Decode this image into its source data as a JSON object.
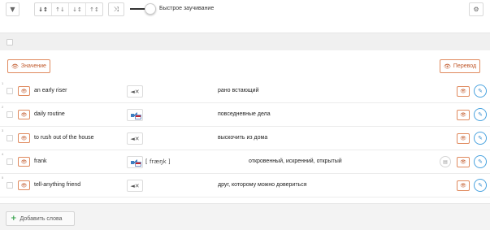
{
  "toolbar": {
    "filter_icon": "filter-icon",
    "sort_options": [
      "↓↕",
      "↑↓",
      "↓↕",
      "↑↕"
    ],
    "shuffle_icon": "shuffle-icon",
    "toggle_on": true,
    "toggle_label": "Быстрое заучивание",
    "settings_icon": "gear-icon"
  },
  "columns": {
    "meaning_label": "Значение",
    "translation_label": "Перевод"
  },
  "rows": [
    {
      "num": "1",
      "term": "an early riser",
      "audio": "none",
      "transcription": "",
      "translation": "рано встающий",
      "has_note": false
    },
    {
      "num": "2",
      "term": "daily routine",
      "audio": "sound",
      "transcription": "",
      "translation": "повседневные дела",
      "has_note": false
    },
    {
      "num": "3",
      "term": "to rush out of the house",
      "audio": "none",
      "transcription": "",
      "translation": "выскочить из дома",
      "has_note": false
    },
    {
      "num": "4",
      "term": "frank",
      "audio": "sound",
      "transcription": "[ fræŋk ]",
      "translation": "откровенный, искренний, открытый",
      "has_note": true
    },
    {
      "num": "5",
      "term": "tell-anything friend",
      "audio": "none",
      "transcription": "",
      "translation": "друг, которому можно довериться",
      "has_note": false
    }
  ],
  "footer": {
    "add_label": "Добавить слова"
  }
}
